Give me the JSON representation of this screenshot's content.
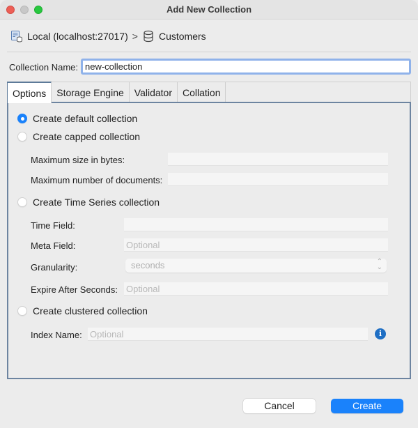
{
  "window": {
    "title": "Add New Collection"
  },
  "breadcrumb": {
    "connection": "Local (localhost:27017)",
    "separator": ">",
    "database": "Customers"
  },
  "collection_name": {
    "label": "Collection Name:",
    "value": "new-collection"
  },
  "tabs": [
    {
      "label": "Options",
      "active": true
    },
    {
      "label": "Storage Engine",
      "active": false
    },
    {
      "label": "Validator",
      "active": false
    },
    {
      "label": "Collation",
      "active": false
    }
  ],
  "options": {
    "default": {
      "label": "Create default collection",
      "checked": true
    },
    "capped": {
      "label": "Create capped collection",
      "checked": false,
      "max_size_label": "Maximum size in bytes:",
      "max_size_value": "",
      "max_docs_label": "Maximum number of documents:",
      "max_docs_value": ""
    },
    "time_series": {
      "label": "Create Time Series collection",
      "checked": false,
      "time_field_label": "Time Field:",
      "time_field_value": "",
      "meta_field_label": "Meta Field:",
      "meta_field_placeholder": "Optional",
      "granularity_label": "Granularity:",
      "granularity_value": "seconds",
      "expire_label": "Expire After Seconds:",
      "expire_placeholder": "Optional"
    },
    "clustered": {
      "label": "Create clustered collection",
      "checked": false,
      "index_name_label": "Index Name:",
      "index_name_placeholder": "Optional",
      "info_glyph": "i"
    }
  },
  "buttons": {
    "cancel": "Cancel",
    "create": "Create"
  },
  "colors": {
    "accent": "#1a82fb",
    "info": "#1f6fc4",
    "panel_border": "#6d84a0"
  }
}
